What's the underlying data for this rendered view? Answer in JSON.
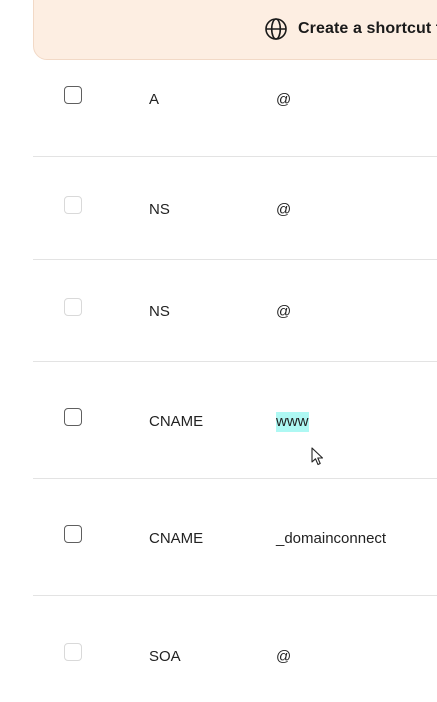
{
  "banner": {
    "icon": "globe-icon",
    "text": "Create a shortcut to"
  },
  "records": [
    {
      "type": "A",
      "name": "@",
      "checkbox_enabled": true,
      "highlighted": false
    },
    {
      "type": "NS",
      "name": "@",
      "checkbox_enabled": false,
      "highlighted": false
    },
    {
      "type": "NS",
      "name": "@",
      "checkbox_enabled": false,
      "highlighted": false
    },
    {
      "type": "CNAME",
      "name": "www",
      "checkbox_enabled": true,
      "highlighted": true
    },
    {
      "type": "CNAME",
      "name": "_domainconnect",
      "checkbox_enabled": true,
      "highlighted": false
    },
    {
      "type": "SOA",
      "name": "@",
      "checkbox_enabled": false,
      "highlighted": false
    }
  ],
  "colors": {
    "banner_bg": "#fdeee2",
    "highlight": "#aef8f3",
    "divider": "#e3e3e3"
  }
}
